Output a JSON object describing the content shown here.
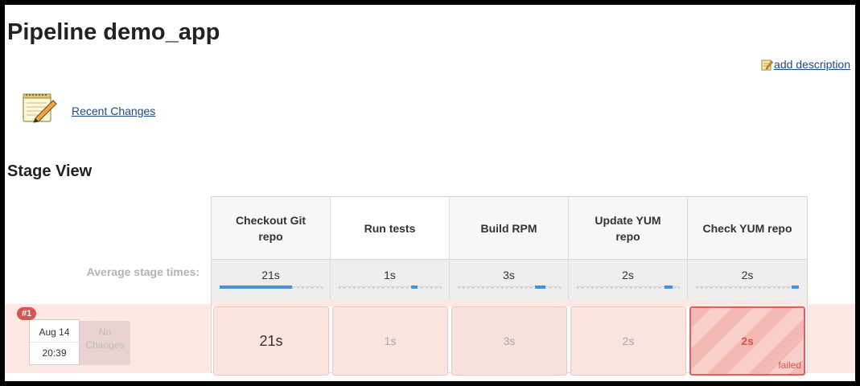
{
  "page": {
    "title": "Pipeline demo_app",
    "add_description": "add description",
    "recent_changes": "Recent Changes",
    "stage_view_title": "Stage View",
    "avg_label": "Average stage times:"
  },
  "stages": [
    {
      "name": "Checkout Git repo",
      "avg": "21s",
      "avg_fraction": 0.7
    },
    {
      "name": "Run tests",
      "avg": "1s",
      "avg_fraction": 0.05
    },
    {
      "name": "Build RPM",
      "avg": "3s",
      "avg_fraction": 0.1
    },
    {
      "name": "Update YUM repo",
      "avg": "2s",
      "avg_fraction": 0.08
    },
    {
      "name": "Check YUM repo",
      "avg": "2s",
      "avg_fraction": 0.07
    }
  ],
  "run": {
    "badge": "#1",
    "date": "Aug 14",
    "time": "20:39",
    "changes": "No Changes",
    "cells": [
      {
        "value": "21s",
        "status": "success"
      },
      {
        "value": "1s",
        "status": "success"
      },
      {
        "value": "3s",
        "status": "success"
      },
      {
        "value": "2s",
        "status": "success"
      },
      {
        "value": "2s",
        "status": "failed",
        "status_label": "failed"
      }
    ]
  },
  "colors": {
    "link": "#204a87",
    "failed": "#d9534f",
    "bar": "#4a90d9",
    "run_row": "#fde8e4"
  }
}
